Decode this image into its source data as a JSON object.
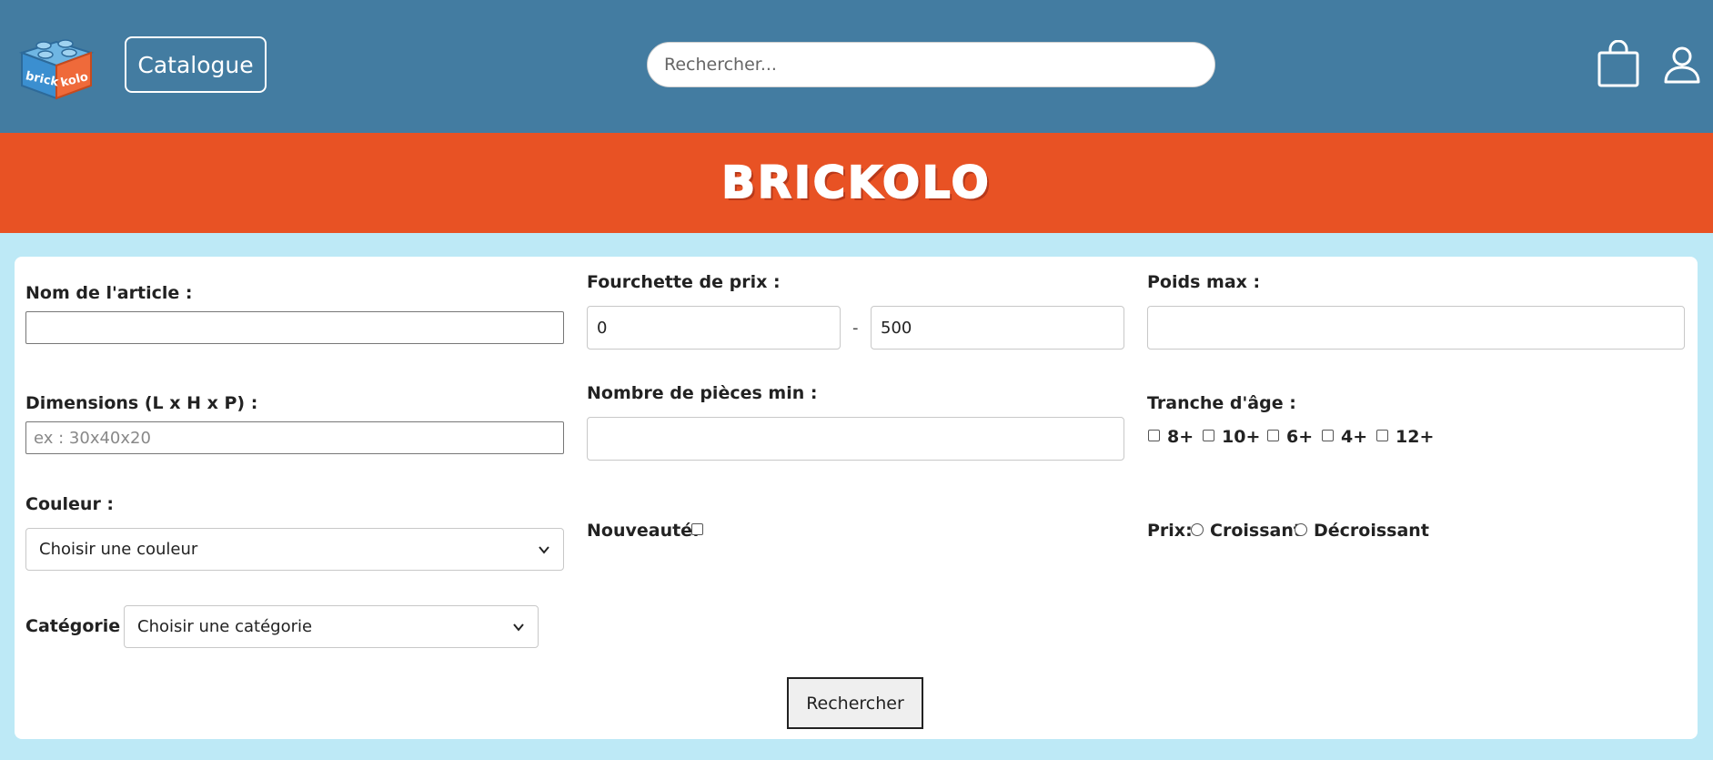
{
  "header": {
    "logo_text_1": "brick",
    "logo_text_2": "kolo",
    "catalogue_label": "Catalogue",
    "search_placeholder": "Rechercher...",
    "colors": {
      "topbar": "#437ca1",
      "banner": "#e85224",
      "page_bg": "#bde9f6"
    }
  },
  "banner": {
    "title": "BRICKOLO"
  },
  "form": {
    "nom_label": "Nom de l'article :",
    "nom_value": "",
    "prix_label": "Fourchette de prix :",
    "prix_min": "0",
    "prix_sep": "-",
    "prix_max": "500",
    "poids_label": "Poids max :",
    "poids_value": "",
    "dimensions_label": "Dimensions (L x H x P) :",
    "dimensions_placeholder": "ex : 30x40x20",
    "pieces_label": "Nombre de pièces min :",
    "pieces_value": "",
    "age_label": "Tranche d'âge :",
    "ages": [
      "8+",
      "10+",
      "6+",
      "4+",
      "12+"
    ],
    "couleur_label": "Couleur :",
    "couleur_selected": "Choisir une couleur",
    "nouveaute_label": "Nouveauté:",
    "prix_sort_label": "Prix:",
    "sort_asc": "Croissant",
    "sort_desc": "Décroissant",
    "categorie_label": "Catégorie :",
    "categorie_selected": "Choisir une catégorie",
    "submit_label": "Rechercher"
  }
}
